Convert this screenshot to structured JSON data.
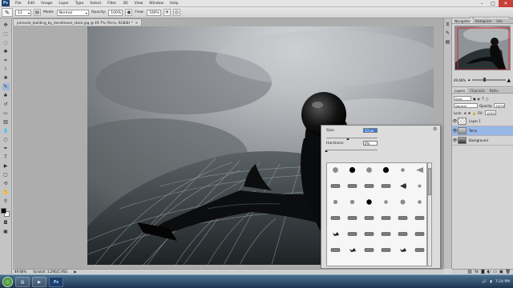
{
  "app": {
    "logo": "Ps"
  },
  "menu": [
    "File",
    "Edit",
    "Image",
    "Layer",
    "Type",
    "Select",
    "Filter",
    "3D",
    "View",
    "Window",
    "Help"
  ],
  "window_controls": {
    "minimize": "–",
    "maximize": "□",
    "close": "✕"
  },
  "options_bar": {
    "brush_size_value": "13",
    "mode_label": "Mode:",
    "mode_value": "Normal",
    "opacity_label": "Opacity:",
    "opacity_value": "100%",
    "flow_label": "Flow:",
    "flow_value": "100%",
    "workspace_value": "Essentials"
  },
  "document": {
    "tab_title": "pinnacle_building_by_devidmoon_stock.jpg @ 49.7% (Terra, RGB/8) *",
    "zoom": "49.66%",
    "status_info": "Scratch: 1.29G/1.95G"
  },
  "brush_picker": {
    "size_label": "Size:",
    "size_value": "13 px",
    "hardness_label": "Hardness:",
    "hardness_value": "0%",
    "brush_numbers": [
      "",
      "",
      "",
      "",
      "",
      "",
      "",
      "",
      "",
      "",
      "",
      "",
      "",
      "",
      "",
      "",
      "",
      "",
      "",
      "",
      "",
      "",
      "",
      "",
      "",
      "",
      "",
      "",
      "",
      "",
      "",
      "",
      "",
      "",
      "",
      ""
    ]
  },
  "navigator": {
    "tabs": [
      "Navigator",
      "Histogram",
      "Info"
    ],
    "zoom": "49.66%"
  },
  "layers_panel": {
    "tabs": [
      "Layers",
      "Channels",
      "Paths"
    ],
    "kind_label": "Kind",
    "blend_mode": "Normal",
    "opacity_label": "Opacity:",
    "opacity_value": "100%",
    "lock_label": "Lock:",
    "fill_label": "Fill:",
    "fill_value": "100%",
    "layers": [
      {
        "name": "Layer 1",
        "selected": false
      },
      {
        "name": "Terra",
        "selected": true
      },
      {
        "name": "Background",
        "selected": false
      }
    ]
  },
  "taskbar": {
    "time": "7:24 PM"
  },
  "colors": {
    "accent": "#3d7bd6",
    "selected_layer": "#98b6e6",
    "taskbar": "#1f3550"
  }
}
